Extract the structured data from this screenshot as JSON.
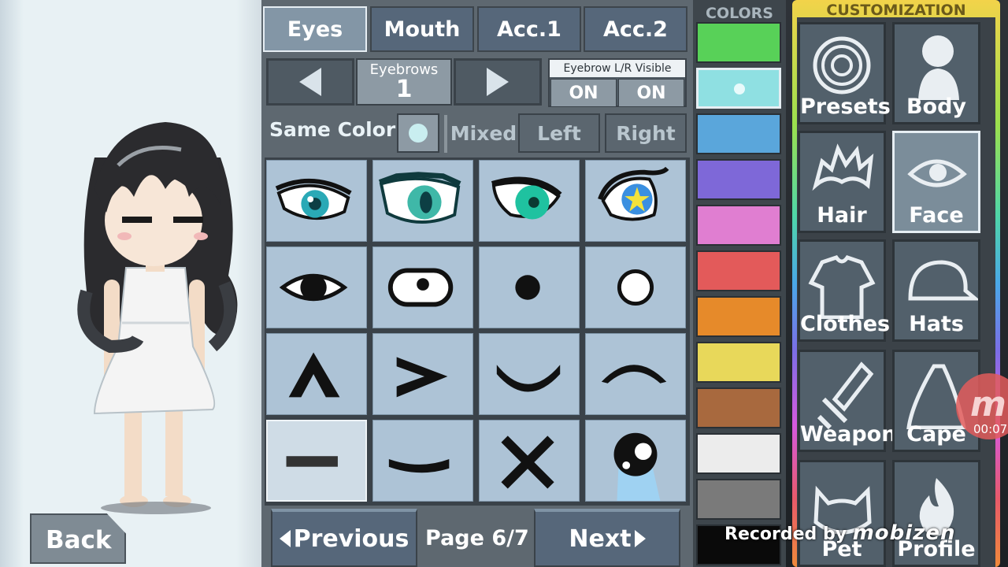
{
  "tabs": [
    {
      "label": "Eyes",
      "active": true
    },
    {
      "label": "Mouth",
      "active": false
    },
    {
      "label": "Acc.1",
      "active": false
    },
    {
      "label": "Acc.2",
      "active": false
    }
  ],
  "eyebrows": {
    "label": "Eyebrows",
    "value": "1"
  },
  "eyebrow_visibility": {
    "title": "Eyebrow L/R Visible",
    "left": "ON",
    "right": "ON"
  },
  "color_mode": {
    "same_color": "Same Color",
    "mixed": "Mixed",
    "left": "Left",
    "right": "Right",
    "same_color_swatch": "#c9eef0"
  },
  "grid": {
    "selected_index": 12,
    "items": [
      "anime-eye-teal-1",
      "anime-eye-teal-2",
      "anime-eye-green",
      "anime-eye-star",
      "simple-eye-almond",
      "simple-eye-wide",
      "dot-eye",
      "circle-eye",
      "caret-up-eye",
      "greater-than-eye",
      "smile-curve-eye",
      "arc-eye",
      "dash-eye",
      "flat-curve-eye",
      "x-eye",
      "crying-eye"
    ]
  },
  "pagination": {
    "previous": "Previous",
    "page": "Page 6/7",
    "next": "Next"
  },
  "back_label": "Back",
  "colors": {
    "title": "COLORS",
    "selected_index": 1,
    "swatches": [
      "#58d158",
      "#8fe0e2",
      "#5aa6db",
      "#7e68d8",
      "#e07ed1",
      "#e35a5a",
      "#e68a2a",
      "#e8d85a",
      "#a8693e",
      "#ececec",
      "#7a7a7a",
      "#0a0a0a"
    ]
  },
  "customization": {
    "title": "CUSTOMIZATION",
    "items": [
      {
        "label": "Presets",
        "icon": "presets-icon",
        "active": false
      },
      {
        "label": "Body",
        "icon": "body-icon",
        "active": false
      },
      {
        "label": "Hair",
        "icon": "hair-icon",
        "active": false
      },
      {
        "label": "Face",
        "icon": "face-icon",
        "active": true
      },
      {
        "label": "Clothes",
        "icon": "clothes-icon",
        "active": false
      },
      {
        "label": "Hats",
        "icon": "hats-icon",
        "active": false
      },
      {
        "label": "Weapon",
        "icon": "weapon-icon",
        "active": false
      },
      {
        "label": "Cape",
        "icon": "cape-icon",
        "active": false
      },
      {
        "label": "Pet",
        "icon": "pet-icon",
        "active": false
      },
      {
        "label": "Profile",
        "icon": "profile-icon",
        "active": false
      }
    ]
  },
  "recording": {
    "time": "00:07",
    "watermark_prefix": "Recorded by",
    "watermark_brand": "mobizen",
    "badge_letter": "m"
  }
}
